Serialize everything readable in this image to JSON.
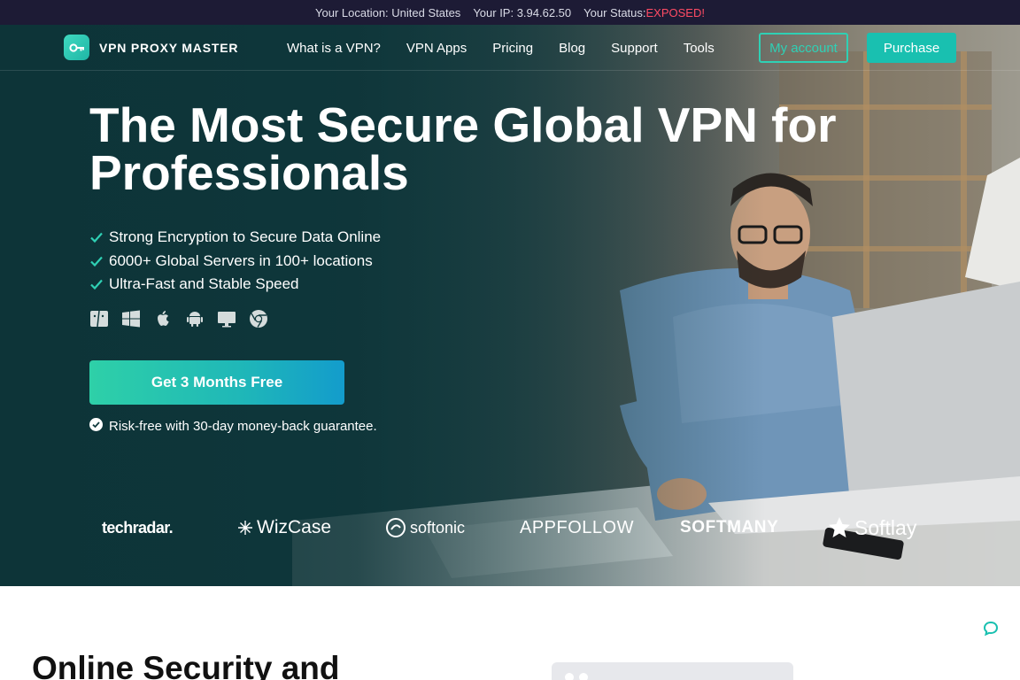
{
  "topbar": {
    "location": "Your Location: United States",
    "ip": "Your IP: 3.94.62.50",
    "status_label": "Your Status:",
    "status_value": "EXPOSED!"
  },
  "nav": {
    "brand": "VPN PROXY MASTER",
    "links": [
      "What is a VPN?",
      "VPN Apps",
      "Pricing",
      "Blog",
      "Support",
      "Tools"
    ],
    "my_account": "My account",
    "purchase": "Purchase"
  },
  "hero": {
    "title_line1": "The Most Secure Global VPN for",
    "title_line2": "Professionals",
    "features": [
      "Strong Encryption to Secure Data Online",
      "6000+ Global Servers in 100+ locations",
      "Ultra-Fast and Stable Speed"
    ],
    "platform_icons": [
      "finder-icon",
      "windows-icon",
      "apple-icon",
      "android-icon",
      "tv-icon",
      "chrome-icon"
    ],
    "cta": "Get 3 Months Free",
    "guarantee": "Risk-free with 30-day money-back guarantee."
  },
  "press": {
    "techradar": "techradar.",
    "wizcase": "WizCase",
    "softonic": "softonic",
    "appfollow": "APPFOLLOW",
    "softmany": "SOFTMANY",
    "softlay": "Softlay"
  },
  "section": {
    "title": "Online Security and"
  },
  "colors": {
    "accent": "#19c0b0",
    "topbar_bg": "#1d1b35",
    "exposed": "#ff4b64",
    "hero_overlay": "#0d3438"
  }
}
